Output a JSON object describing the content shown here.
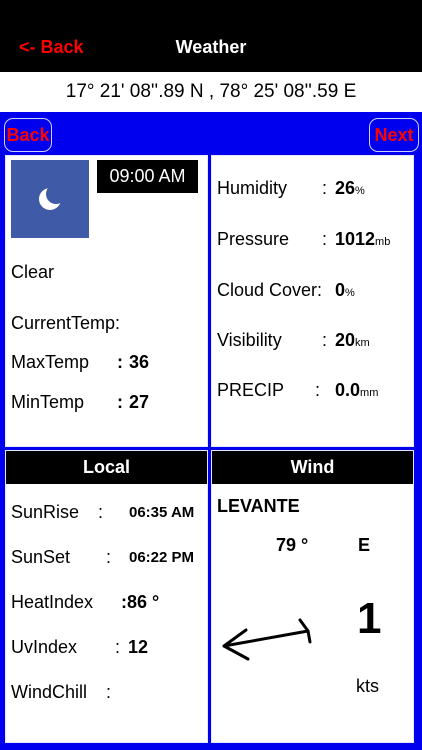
{
  "nav": {
    "back_label": "<- Back",
    "title": "Weather"
  },
  "coordinates": "17° 21' 08''.89 N  ,  78° 25' 08''.59 E",
  "controls": {
    "back_label": "Back",
    "next_label": "Next"
  },
  "conditions": {
    "icon": "moon-icon",
    "time": "09:00 AM",
    "summary": "Clear",
    "current_temp_label": "CurrentTemp:",
    "max_temp_label": "MaxTemp",
    "max_temp_colon": ":",
    "max_temp_value": "36",
    "min_temp_label": "MinTemp",
    "min_temp_colon": ":",
    "min_temp_value": "27"
  },
  "stats": {
    "humidity_label": "Humidity",
    "humidity_colon": ":",
    "humidity_value": "26",
    "humidity_unit": "%",
    "pressure_label": "Pressure",
    "pressure_colon": ":",
    "pressure_value": "1012",
    "pressure_unit": "mb",
    "cloud_label": "Cloud Cover:",
    "cloud_value": "0",
    "cloud_unit": "%",
    "visibility_label": "Visibility",
    "visibility_colon": ":",
    "visibility_value": "20",
    "visibility_unit": "km",
    "precip_label": "PRECIP",
    "precip_colon": ":",
    "precip_value": "0.0",
    "precip_unit": "mm"
  },
  "local": {
    "header": "Local",
    "sunrise_label": "SunRise",
    "sunrise_colon": ":",
    "sunrise_value": "06:35 AM",
    "sunset_label": "SunSet",
    "sunset_colon": ":",
    "sunset_value": "06:22 PM",
    "heat_label": "HeatIndex",
    "heat_value": ":86 °",
    "uv_label": "UvIndex",
    "uv_colon": ":",
    "uv_value": "12",
    "windchill_label": "WindChill",
    "windchill_colon": ":"
  },
  "wind": {
    "header": "Wind",
    "name": "LEVANTE",
    "degrees": "79 °",
    "direction": "E",
    "arrow_icon": "wind-arrow-icon",
    "speed": "1",
    "unit": "kts"
  }
}
